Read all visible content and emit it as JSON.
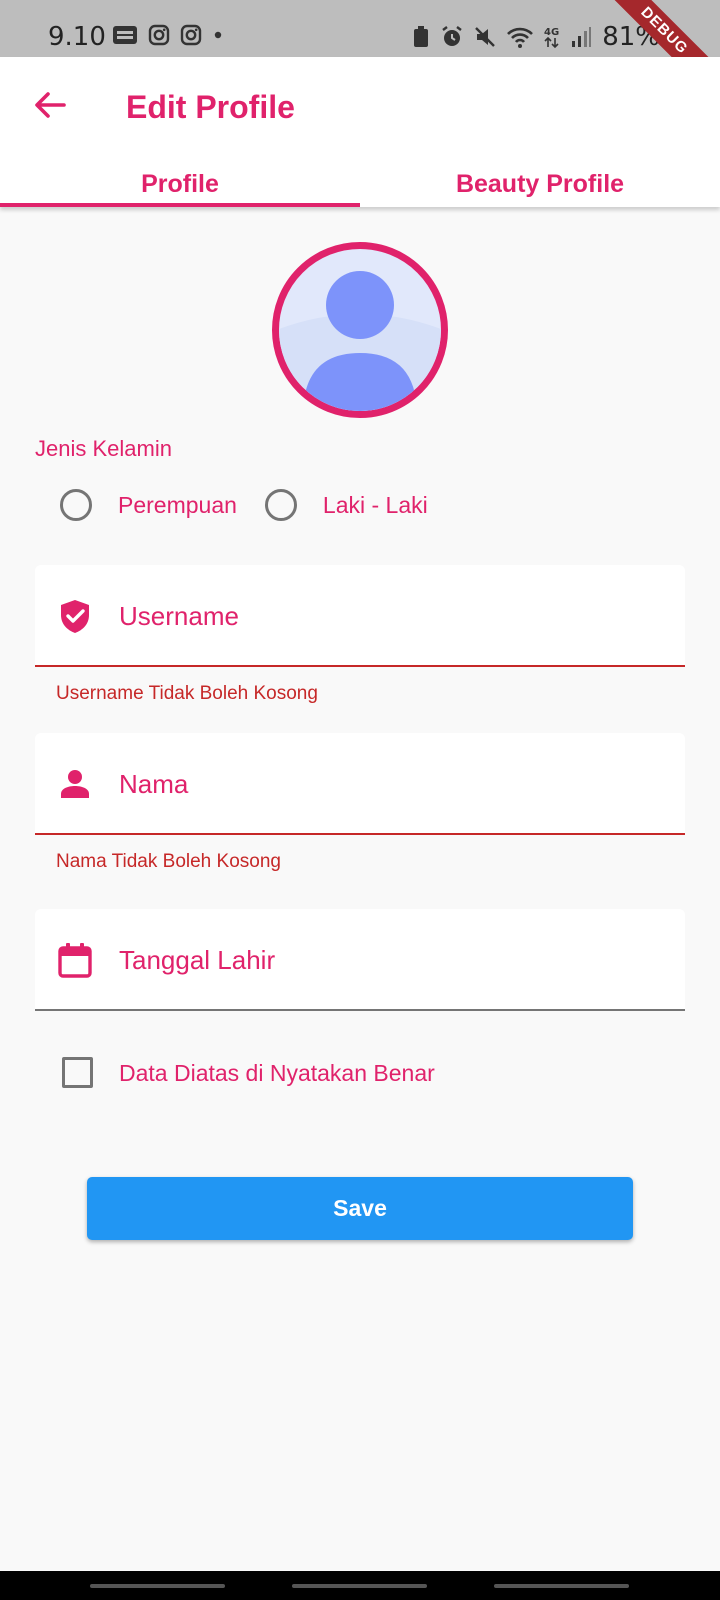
{
  "status_bar": {
    "time": "9.10",
    "battery": "81%",
    "debug_banner": "DEBUG"
  },
  "app_bar": {
    "title": "Edit Profile"
  },
  "tabs": [
    {
      "label": "Profile",
      "active": true
    },
    {
      "label": "Beauty Profile",
      "active": false
    }
  ],
  "gender": {
    "label": "Jenis Kelamin",
    "options": [
      "Perempuan",
      "Laki - Laki"
    ]
  },
  "fields": {
    "username": {
      "label": "Username",
      "error": "Username Tidak Boleh Kosong",
      "icon": "verified-shield-icon"
    },
    "name": {
      "label": "Nama",
      "error": "Nama Tidak Boleh Kosong",
      "icon": "person-icon"
    },
    "birthdate": {
      "label": "Tanggal Lahir",
      "icon": "calendar-icon"
    }
  },
  "agreement": {
    "label": "Data Diatas di Nyatakan Benar",
    "checked": false
  },
  "save_button": {
    "label": "Save"
  },
  "colors": {
    "accent": "#e0226b",
    "error": "#c62828",
    "button": "#2196f3",
    "background": "#f9f9f9"
  }
}
